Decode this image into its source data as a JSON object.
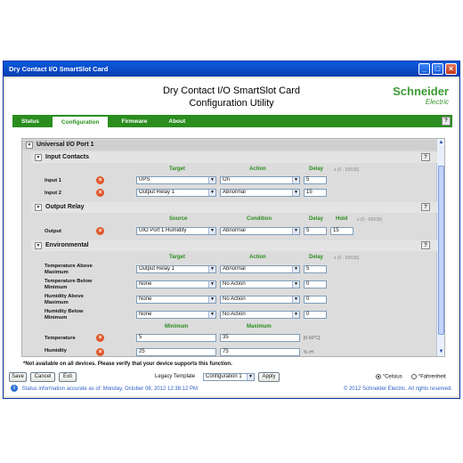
{
  "window": {
    "title": "Dry Contact I/O SmartSlot Card"
  },
  "header": {
    "title_line1": "Dry Contact I/O SmartSlot Card",
    "title_line2": "Configuration Utility",
    "logo_line1": "Schneider",
    "logo_line2": "Electric"
  },
  "tabs": [
    {
      "label": "Status",
      "active": false
    },
    {
      "label": "Configuration",
      "active": true
    },
    {
      "label": "Firmware",
      "active": false
    },
    {
      "label": "About",
      "active": false
    }
  ],
  "help": "?",
  "universal_port": {
    "title": "Universal I/O Port 1"
  },
  "input_contacts": {
    "title": "Input Contacts",
    "col_target": "Target",
    "col_action": "Action",
    "col_delay": "Delay",
    "range": "s (0 - 65535)",
    "rows": [
      {
        "label": "Input 1",
        "target": "UPS",
        "action": "On",
        "delay": "5"
      },
      {
        "label": "Input 2",
        "target": "Output Relay 1",
        "action": "Abnormal",
        "delay": "15"
      }
    ]
  },
  "output_relay": {
    "title": "Output Relay",
    "col_source": "Source",
    "col_condition": "Condition",
    "col_delay": "Delay",
    "col_hold": "Hold",
    "range": "s (0 - 65535)",
    "row": {
      "label": "Output",
      "source": "UIO Port 1 Humidity",
      "condition": "Abnormal",
      "delay": "5",
      "hold": "15"
    }
  },
  "environmental": {
    "title": "Environmental",
    "col_target": "Target",
    "col_action": "Action",
    "col_delay": "Delay",
    "range": "s (0 - 65535)",
    "rows": [
      {
        "label": "Temperature Above Maximum",
        "target": "Output Relay 1",
        "action": "Abnormal",
        "delay": "5"
      },
      {
        "label": "Temperature Below Minimum",
        "target": "None",
        "action": "No Action",
        "delay": "0"
      },
      {
        "label": "Humidity Above Maximum",
        "target": "None",
        "action": "No Action",
        "delay": "0"
      },
      {
        "label": "Humidity Below Minimum",
        "target": "None",
        "action": "No Action",
        "delay": "0"
      }
    ],
    "col_minimum": "Minimum",
    "col_maximum": "Maximum",
    "temperature": {
      "label": "Temperature",
      "min": "5",
      "max": "35",
      "unit": "[0-60°C]"
    },
    "humidity": {
      "label": "Humidity",
      "min": "25",
      "max": "75",
      "unit": "% rH"
    }
  },
  "note": "*Not available on all devices. Please verify that your device supports this function.",
  "bottom": {
    "save": "Save",
    "cancel": "Cancel",
    "exit": "Exit",
    "legacy_label": "Legacy Template",
    "legacy_value": "Configuration 1",
    "apply": "Apply",
    "celsius": "°Celsius",
    "fahrenheit": "°Fahrenheit"
  },
  "status": {
    "text": "Status information accurate as of: Monday, October 08, 2012 12:38:12 PM",
    "copyright": "© 2012 Schneider Electric. All rights reserved."
  }
}
